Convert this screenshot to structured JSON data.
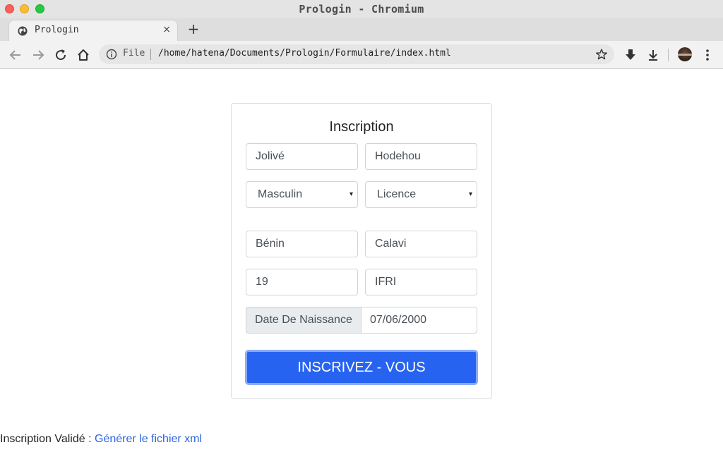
{
  "window": {
    "title": "Prologin - Chromium"
  },
  "tab": {
    "label": "Prologin",
    "close": "×",
    "new_tab": "+"
  },
  "omnibox": {
    "scheme_label": "File",
    "url": "/home/hatena/Documents/Prologin/Formulaire/index.html"
  },
  "form": {
    "title": "Inscription",
    "prenom": "Jolivé",
    "nom": "Hodehou",
    "sexe": "Masculin",
    "niveau": "Licence",
    "pays": "Bénin",
    "ville": "Calavi",
    "age": "19",
    "ecole": "IFRI",
    "date_label": "Date De Naissance",
    "date_value": "07/06/2000",
    "submit_label": "INSCRIVEZ - VOUS",
    "select_caret": "▾"
  },
  "status": {
    "text": "Inscription Validé :",
    "link": "Générer le fichier xml"
  },
  "colors": {
    "primary": "#2663f1",
    "link": "#2b63e0",
    "border": "#ced4da"
  }
}
